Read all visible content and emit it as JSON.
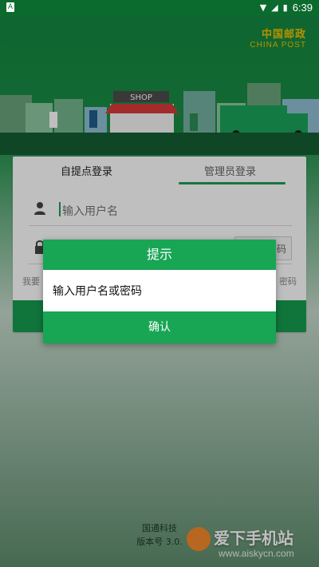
{
  "status_bar": {
    "time": "6:39",
    "left_badge": "A",
    "icons": [
      "wifi-icon",
      "signal-icon",
      "battery-icon"
    ]
  },
  "header": {
    "logo_cn": "中国邮政",
    "logo_en": "CHINA POST",
    "shop_sign": "SHOP"
  },
  "login": {
    "tabs": [
      {
        "label": "自提点登录"
      },
      {
        "label": "管理员登录"
      }
    ],
    "username_placeholder": "输入用户名",
    "get_code_label": "码",
    "register_label": "我要",
    "forgot_label": "密码"
  },
  "dialog": {
    "title": "提示",
    "message": "输入用户名或密码",
    "confirm": "确认"
  },
  "footer": {
    "company": "国通科技",
    "version": "版本号 3.0."
  },
  "watermark": {
    "text": "爱下手机站",
    "url": "www.aiskycn.com"
  },
  "colors": {
    "primary_green": "#18a655",
    "status_bar_green": "#0b6a2e",
    "logo_yellow": "#f2c300"
  }
}
